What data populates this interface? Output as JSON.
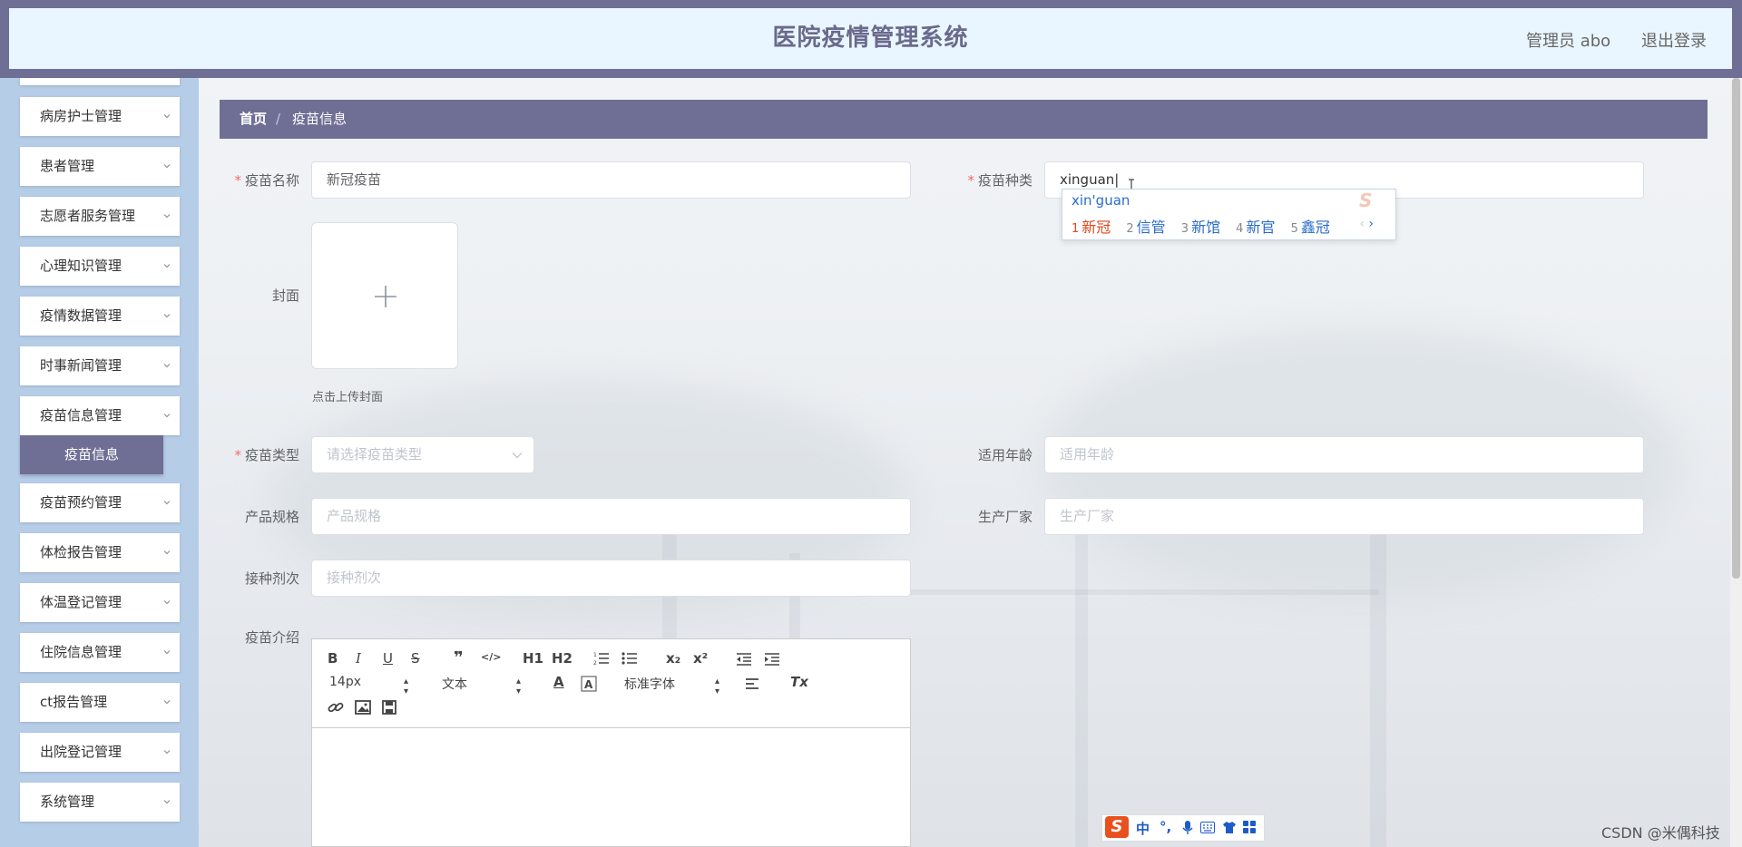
{
  "header": {
    "title": "医院疫情管理系统",
    "user": "管理员 abo",
    "logout": "退出登录"
  },
  "sidebar": {
    "items": [
      {
        "label": "病房护士管理"
      },
      {
        "label": "患者管理"
      },
      {
        "label": "志愿者服务管理"
      },
      {
        "label": "心理知识管理"
      },
      {
        "label": "疫情数据管理"
      },
      {
        "label": "时事新闻管理"
      },
      {
        "label": "疫苗信息管理"
      },
      {
        "label": "疫苗预约管理"
      },
      {
        "label": "体检报告管理"
      },
      {
        "label": "体温登记管理"
      },
      {
        "label": "住院信息管理"
      },
      {
        "label": "ct报告管理"
      },
      {
        "label": "出院登记管理"
      },
      {
        "label": "系统管理"
      }
    ],
    "active_sub": "疫苗信息"
  },
  "breadcrumb": {
    "home": "首页",
    "sep": "/",
    "current": "疫苗信息"
  },
  "form": {
    "name_label": "疫苗名称",
    "name_value": "新冠疫苗",
    "kind_label": "疫苗种类",
    "kind_value": "xinguan",
    "cover_label": "封面",
    "cover_hint": "点击上传封面",
    "type_label": "疫苗类型",
    "type_placeholder": "请选择疫苗类型",
    "age_label": "适用年龄",
    "age_placeholder": "适用年龄",
    "spec_label": "产品规格",
    "spec_placeholder": "产品规格",
    "maker_label": "生产厂家",
    "maker_placeholder": "生产厂家",
    "dose_label": "接种剂次",
    "dose_placeholder": "接种剂次",
    "intro_label": "疫苗介绍"
  },
  "ime": {
    "pinyin": "xin'guan",
    "candidates": [
      {
        "n": "1",
        "text": "新冠"
      },
      {
        "n": "2",
        "text": "信管"
      },
      {
        "n": "3",
        "text": "新馆"
      },
      {
        "n": "4",
        "text": "新官"
      },
      {
        "n": "5",
        "text": "鑫冠"
      }
    ],
    "status": [
      "中",
      "°,",
      "🎤",
      "⌨",
      "👕",
      "▦"
    ]
  },
  "editor": {
    "font_size": "14px",
    "header_select": "文本",
    "font_select": "标准字体",
    "buttons": [
      "B",
      "I",
      "U",
      "S",
      "❞",
      "</>",
      "H1",
      "H2",
      "ol",
      "ul",
      "x₂",
      "x²",
      "outdent",
      "indent",
      "A",
      "A-bg",
      "align",
      "Tx",
      "link",
      "image",
      "video"
    ]
  },
  "watermark": "CSDN @米偶科技"
}
